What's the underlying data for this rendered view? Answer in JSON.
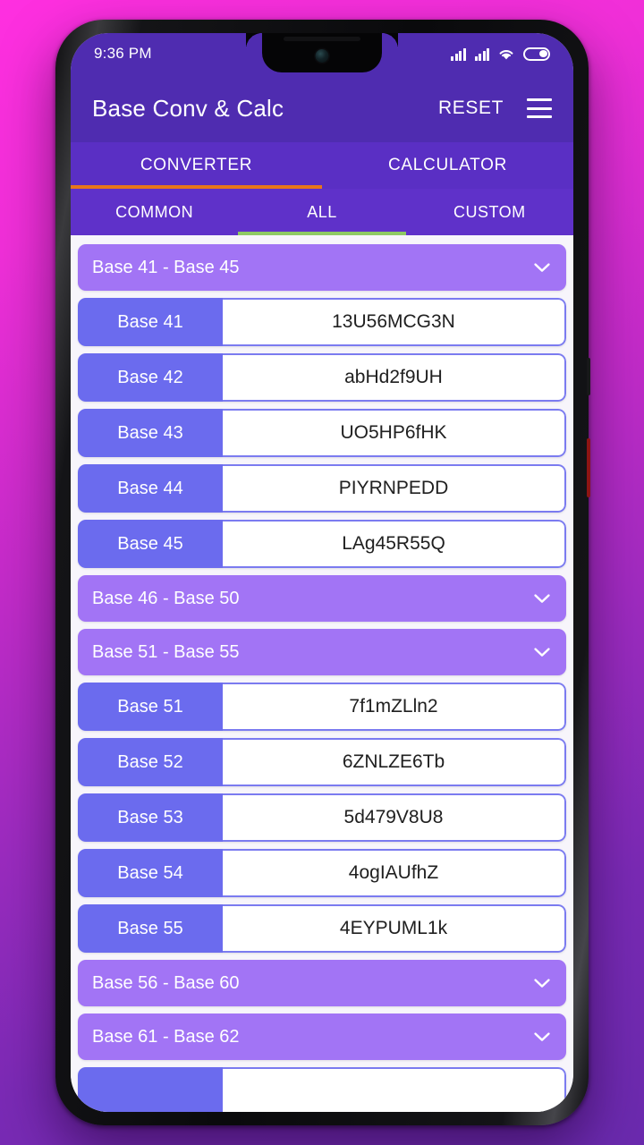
{
  "status_bar": {
    "clock": "9:36 PM",
    "icons": [
      "signal-bars-icon",
      "signal-bars-icon",
      "wifi-icon",
      "battery-icon"
    ]
  },
  "app_bar": {
    "title": "Base Conv & Calc",
    "reset_label": "RESET",
    "menu_icon": "hamburger-menu-icon"
  },
  "primary_tabs": {
    "active": "CONVERTER",
    "indicator_color": "#e8761a",
    "items": [
      {
        "label": "CONVERTER",
        "active": true
      },
      {
        "label": "CALCULATOR",
        "active": false
      }
    ]
  },
  "secondary_tabs": {
    "active": "ALL",
    "indicator_color": "#8ec963",
    "items": [
      {
        "label": "COMMON",
        "active": false
      },
      {
        "label": "ALL",
        "active": true
      },
      {
        "label": "CUSTOM",
        "active": false
      }
    ]
  },
  "colors": {
    "app_bar": "#4f2cb0",
    "primary_tab_bar": "#5a2fc4",
    "secondary_tab_bar": "#5f31c9",
    "group_header": "#a274f5",
    "row_label": "#6b6bee",
    "row_value_border": "#7b7bf0",
    "list_background": "#f7f5fb",
    "wallpaper_start": "#ff2fe0",
    "wallpaper_end": "#6a2aae"
  },
  "list": [
    {
      "kind": "group",
      "label": "Base 41 - Base 45",
      "expanded": true,
      "chevron": "chevron-down-icon"
    },
    {
      "kind": "row",
      "label": "Base 41",
      "value": "13U56MCG3N"
    },
    {
      "kind": "row",
      "label": "Base 42",
      "value": "abHd2f9UH"
    },
    {
      "kind": "row",
      "label": "Base 43",
      "value": "UO5HP6fHK"
    },
    {
      "kind": "row",
      "label": "Base 44",
      "value": "PIYRNPEDD"
    },
    {
      "kind": "row",
      "label": "Base 45",
      "value": "LAg45R55Q"
    },
    {
      "kind": "group",
      "label": "Base 46 - Base 50",
      "expanded": false,
      "chevron": "chevron-down-icon"
    },
    {
      "kind": "group",
      "label": "Base 51 - Base 55",
      "expanded": true,
      "chevron": "chevron-down-icon"
    },
    {
      "kind": "row",
      "label": "Base 51",
      "value": "7f1mZLln2"
    },
    {
      "kind": "row",
      "label": "Base 52",
      "value": "6ZNLZE6Tb"
    },
    {
      "kind": "row",
      "label": "Base 53",
      "value": "5d479V8U8"
    },
    {
      "kind": "row",
      "label": "Base 54",
      "value": "4ogIAUfhZ"
    },
    {
      "kind": "row",
      "label": "Base 55",
      "value": "4EYPUML1k"
    },
    {
      "kind": "group",
      "label": "Base 56 - Base 60",
      "expanded": false,
      "chevron": "chevron-down-icon"
    },
    {
      "kind": "group",
      "label": "Base 61 - Base 62",
      "expanded": false,
      "chevron": "chevron-down-icon"
    },
    {
      "kind": "row",
      "label": "",
      "value": "",
      "clipped": true
    }
  ]
}
